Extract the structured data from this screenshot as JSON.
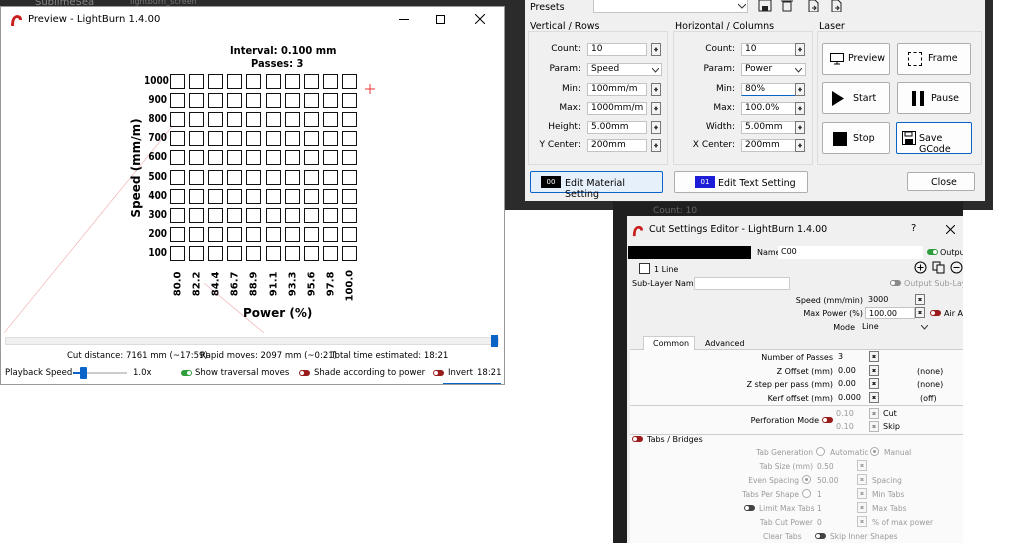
{
  "bg": {
    "tab1": "SublimeSea",
    "tab2": "lightburn_screen"
  },
  "preview": {
    "title": "Preview - LightBurn 1.4.00",
    "interval": "Interval:  0.100 mm",
    "passes": "Passes:  3",
    "y_axis": "Speed (mm/m)",
    "x_axis": "Power (%)",
    "rows": [
      "1000",
      "900",
      "800",
      "700",
      "600",
      "500",
      "400",
      "300",
      "200",
      "100"
    ],
    "cols": [
      "80.0",
      "82.2",
      "84.4",
      "86.7",
      "88.9",
      "91.1",
      "93.3",
      "95.6",
      "97.8",
      "100.0"
    ],
    "cut_distance": "Cut distance: 7161 mm (~17:59)",
    "rapid_moves": "Rapid moves: 2097 mm (~0:21)",
    "total_time": "Total time estimated: 18:21",
    "playback_speed": "Playback Speed",
    "speed_value": "1.0x",
    "speed_fraction": 0.18,
    "show_traversal": "Show traversal moves",
    "shade_power": "Shade according to power",
    "invert": "Invert",
    "time_end": "18:21"
  },
  "grid": {
    "presets_label": "Presets",
    "vertical_header": "Vertical / Rows",
    "horizontal_header": "Horizontal / Columns",
    "laser_header": "Laser",
    "v": {
      "count_l": "Count:",
      "count": "10",
      "param_l": "Param:",
      "param": "Speed",
      "min_l": "Min:",
      "min": "100mm/m",
      "max_l": "Max:",
      "max": "1000mm/m",
      "height_l": "Height:",
      "height": "5.00mm",
      "yc_l": "Y Center:",
      "yc": "200mm"
    },
    "h": {
      "count_l": "Count:",
      "count": "10",
      "param_l": "Param:",
      "param": "Power",
      "min_l": "Min:",
      "min": "80%",
      "max_l": "Max:",
      "max": "100.0%",
      "width_l": "Width:",
      "width": "5.00mm",
      "xc_l": "X Center:",
      "xc": "200mm"
    },
    "buttons": {
      "preview": "Preview",
      "frame": "Frame",
      "start": "Start",
      "pause": "Pause",
      "stop": "Stop",
      "save": "Save GCode"
    },
    "edit_material_num": "00",
    "edit_material": "Edit Material Setting",
    "edit_text_num": "01",
    "edit_text": "Edit Text Setting",
    "close": "Close",
    "behind_count": "Count:  10"
  },
  "cut": {
    "title": "Cut Settings Editor - LightBurn 1.4.00",
    "help": "?",
    "name_label": "Name",
    "name_value": "C00",
    "output": "Output",
    "line_count": "1 Line",
    "sublayer_name": "Sub-Layer Name",
    "output_sublayer": "Output Sub-Layer",
    "speed_l": "Speed (mm/min)",
    "speed": "3000",
    "maxpower_l": "Max Power (%)",
    "maxpower": "100.00",
    "air_assist": "Air Assist",
    "mode_l": "Mode",
    "mode": "Line",
    "tab_common": "Common",
    "tab_advanced": "Advanced",
    "passes_l": "Number of Passes",
    "passes": "3",
    "zoff_l": "Z Offset (mm)",
    "zoff": "0.00",
    "zoff_n": "(none)",
    "zstep_l": "Z step per pass (mm)",
    "zstep": "0.00",
    "zstep_n": "(none)",
    "kerf_l": "Kerf offset (mm)",
    "kerf": "0.000",
    "kerf_n": "(off)",
    "perf_l": "Perforation Mode",
    "perf_cut_v": "0.10",
    "perf_cut": "Cut",
    "perf_skip_v": "0.10",
    "perf_skip": "Skip",
    "tabs_l": "Tabs / Bridges",
    "tabgen_l": "Tab Generation",
    "automatic": "Automatic",
    "manual": "Manual",
    "tabsize_l": "Tab Size (mm)",
    "tabsize": "0.50",
    "even_l": "Even Spacing",
    "spacing_v": "50.00",
    "spacing": "Spacing",
    "per_shape_l": "Tabs Per Shape",
    "per_shape": "1",
    "min_tabs": "Min Tabs",
    "limit_l": "Limit Max Tabs",
    "limit_v": "1",
    "max_tabs": "Max Tabs",
    "cutpower_l": "Tab Cut Power",
    "cutpower": "0",
    "cutpower_u": "% of max power",
    "clear_tabs": "Clear Tabs",
    "skip_inner": "Skip Inner Shapes"
  }
}
